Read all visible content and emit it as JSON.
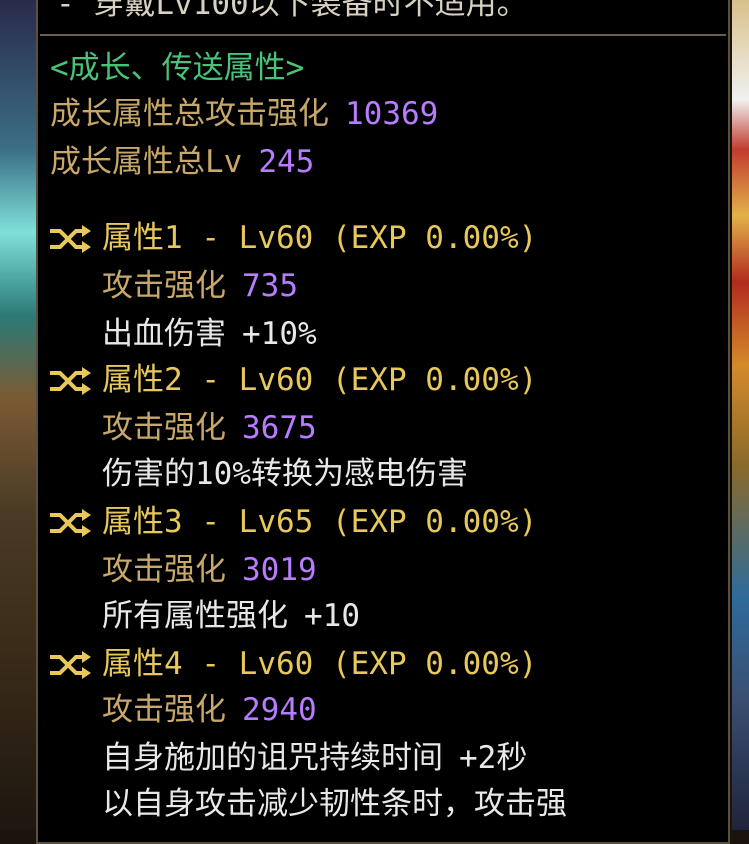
{
  "header_line": "- 穿戴Lv100以下装备时不适用。",
  "section_title": "<成长、传送属性>",
  "total_attack": {
    "label": "成长属性总攻击强化",
    "value": "10369"
  },
  "total_lv": {
    "label": "成长属性总Lv",
    "value": "245"
  },
  "attributes": [
    {
      "title": "属性1 - Lv60 (EXP 0.00%)",
      "attack_label": "攻击强化",
      "attack_value": "735",
      "effect": "出血伤害",
      "effect_value": "+10%"
    },
    {
      "title": "属性2 - Lv60 (EXP 0.00%)",
      "attack_label": "攻击强化",
      "attack_value": "3675",
      "effect": "伤害的10%转换为感电伤害",
      "effect_value": ""
    },
    {
      "title": "属性3 - Lv65 (EXP 0.00%)",
      "attack_label": "攻击强化",
      "attack_value": "3019",
      "effect": "所有属性强化",
      "effect_value": "+10"
    },
    {
      "title": "属性4 - Lv60 (EXP 0.00%)",
      "attack_label": "攻击强化",
      "attack_value": "2940",
      "effect": "自身施加的诅咒持续时间",
      "effect_value": "+2秒",
      "effect2": "以自身攻击减少韧性条时，攻击强"
    }
  ],
  "icon": "shuffle-icon",
  "colors": {
    "gold": "#c8a86a",
    "yellow": "#e8c85a",
    "purple": "#b77cff",
    "green": "#49c27a",
    "white": "#e8e8e8"
  }
}
